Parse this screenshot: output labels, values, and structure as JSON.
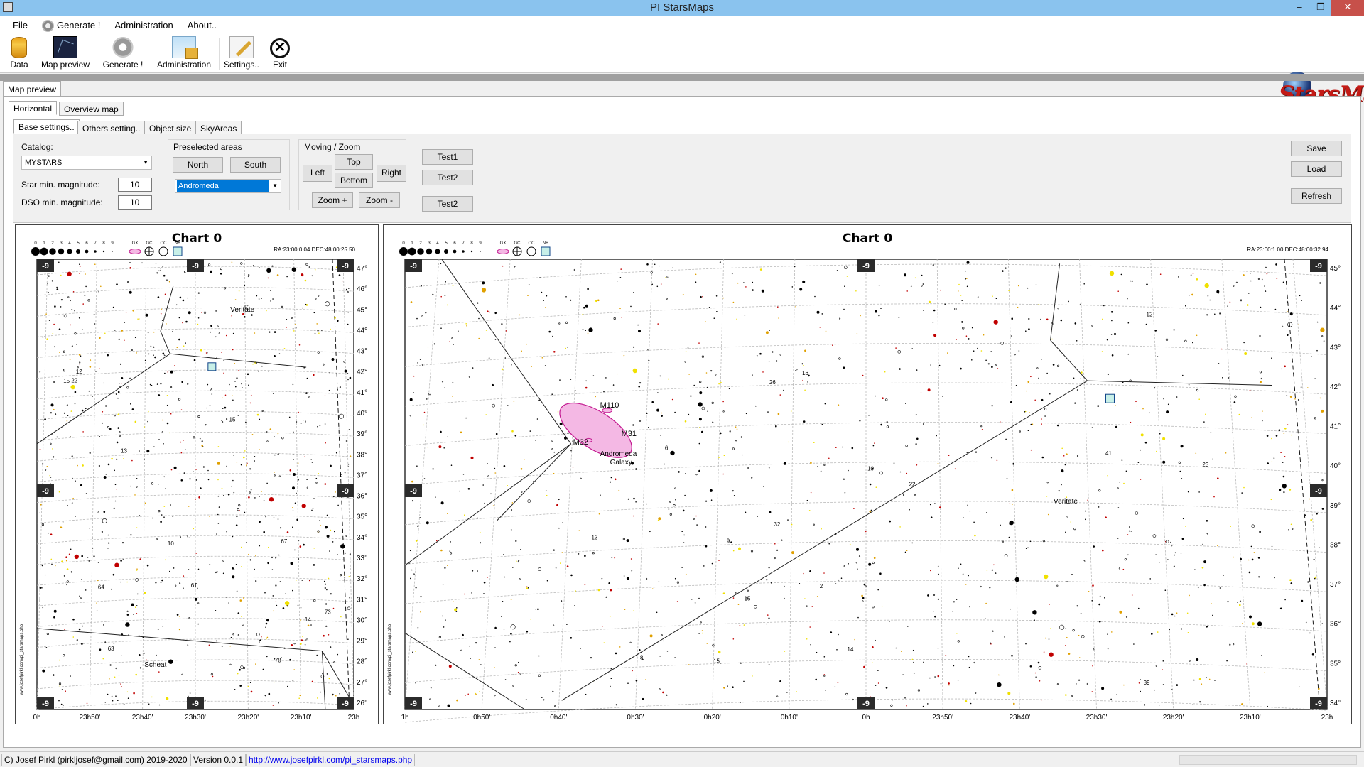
{
  "window": {
    "title": "PI StarsMaps",
    "min": "–",
    "max": "❐",
    "close": "✕"
  },
  "menu": {
    "file": "File",
    "generate": "Generate !",
    "administration": "Administration",
    "about": "About.."
  },
  "toolbar": {
    "data": "Data",
    "map_preview": "Map preview",
    "generate": "Generate !",
    "administration": "Administration",
    "settings": "Settings..",
    "exit": "Exit",
    "exit_glyph": "✕"
  },
  "logo": {
    "text": "StarsMaps"
  },
  "outer_tab": "Map preview",
  "view_tabs": {
    "horizontal": "Horizontal",
    "overview": "Overview map"
  },
  "settings_tabs": {
    "base": "Base settings..",
    "others": "Others setting..",
    "object_size": "Object size",
    "sky_areas": "SkyAreas"
  },
  "base": {
    "catalog_label": "Catalog:",
    "catalog_value": "MYSTARS",
    "star_mag_label": "Star min. magnitude:",
    "star_mag_value": "10",
    "dso_mag_label": "DSO min. magnitude:",
    "dso_mag_value": "10"
  },
  "preselected": {
    "title": "Preselected areas",
    "north": "North",
    "south": "South",
    "area_value": "Andromeda"
  },
  "moving": {
    "title": "Moving / Zoom",
    "left": "Left",
    "top": "Top",
    "right": "Right",
    "bottom": "Bottom",
    "zoom_in": "Zoom +",
    "zoom_out": "Zoom -"
  },
  "tests": {
    "test1": "Test1",
    "test2": "Test2",
    "test3": "Test2"
  },
  "actions": {
    "save": "Save",
    "load": "Load",
    "refresh": "Refresh"
  },
  "chart_left": {
    "title": "Chart 0",
    "coords": "RA:23:00:0.04 DEC:48:00:25.50",
    "mag_legend": [
      "0",
      "1",
      "2",
      "3",
      "4",
      "5",
      "6",
      "7",
      "8",
      "9"
    ],
    "obj_legend": [
      "GX",
      "GC",
      "OC",
      "NB"
    ],
    "dec_ticks": [
      "47°",
      "46°",
      "45°",
      "44°",
      "43°",
      "42°",
      "41°",
      "40°",
      "39°",
      "38°",
      "37°",
      "36°",
      "35°",
      "34°",
      "33°",
      "32°",
      "31°",
      "30°",
      "29°",
      "28°",
      "27°",
      "26°"
    ],
    "ra_ticks": [
      "0h",
      "23h50'",
      "23h40'",
      "23h30'",
      "23h20'",
      "23h10'",
      "23h"
    ],
    "corner_badge": "-9",
    "labels": [
      "Veritate",
      "Scheat",
      "14",
      "15",
      "12",
      "13",
      "10",
      "22",
      "73",
      "67",
      "64",
      "63",
      "78",
      "61",
      "60",
      "15"
    ],
    "credit": "www.josefpirkl.com/pi_starsmaps.php"
  },
  "chart_right": {
    "title": "Chart 0",
    "coords": "RA:23:00:1.00 DEC:48:00:32.94",
    "mag_legend": [
      "0",
      "1",
      "2",
      "3",
      "4",
      "5",
      "6",
      "7",
      "8",
      "9"
    ],
    "obj_legend": [
      "GX",
      "GC",
      "OC",
      "NB"
    ],
    "dec_ticks": [
      "45°",
      "44°",
      "43°",
      "42°",
      "41°",
      "40°",
      "39°",
      "38°",
      "37°",
      "36°",
      "35°",
      "34°"
    ],
    "ra_ticks": [
      "1h",
      "0h50'",
      "0h40'",
      "0h30'",
      "0h20'",
      "0h10'",
      "0h",
      "23h50'",
      "23h40'",
      "23h30'",
      "23h20'",
      "23h10'",
      "23h"
    ],
    "corner_badge": "-9",
    "dso": [
      "M110",
      "M31",
      "M32"
    ],
    "galaxy_name": [
      "Andromeda",
      "Galaxy"
    ],
    "labels": [
      "Veritate",
      "14",
      "15",
      "12",
      "13",
      "10",
      "9",
      "22",
      "26",
      "23",
      "32",
      "39",
      "41",
      "16",
      "15",
      "8",
      "6",
      "2"
    ],
    "credit": "www.josefpirkl.com/pi_starsmaps.php"
  },
  "status": {
    "copyright": "C) Josef Pirkl (pirkljosef@gmail.com) 2019-2020",
    "version": "Version 0.0.1",
    "url": "http://www.josefpirkl.com/pi_starsmaps.php"
  }
}
